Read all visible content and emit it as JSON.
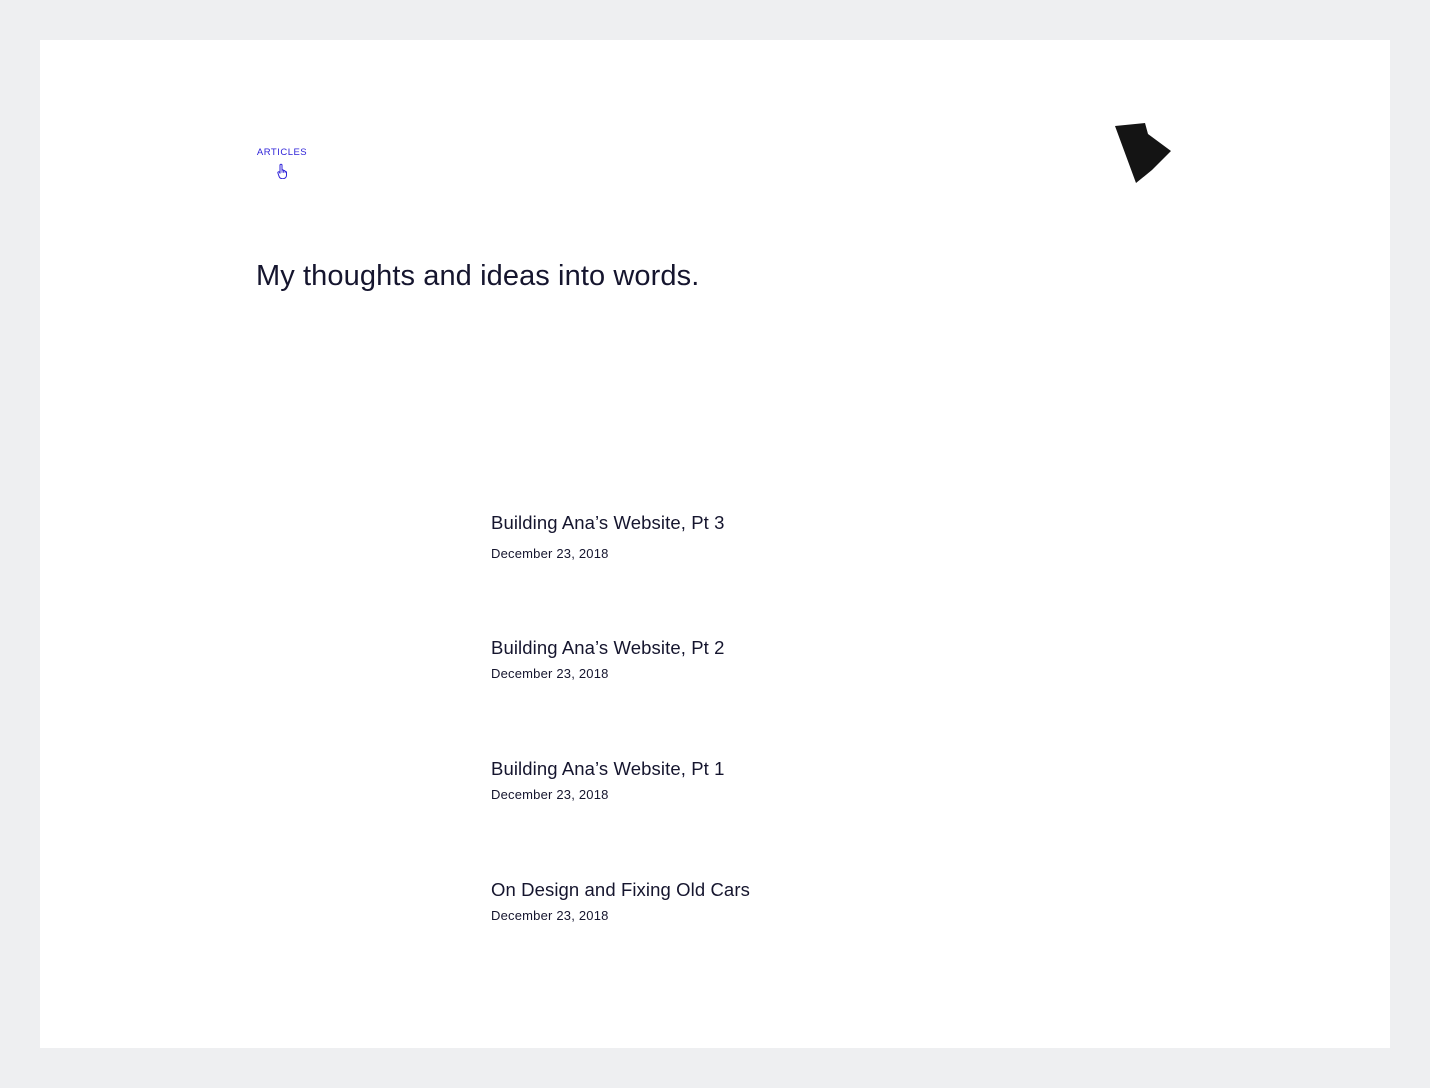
{
  "colors": {
    "background": "#eeeff1",
    "page": "#ffffff",
    "accent": "#2f23d8",
    "text": "#15152e",
    "logo": "#141414"
  },
  "nav": {
    "articles_label": "ARTICLES",
    "articles_icon": "pointing-hand-icon"
  },
  "logo": {
    "icon": "arrow-triangle-logo-icon"
  },
  "header": {
    "tagline": "My thoughts and ideas into words."
  },
  "articles": [
    {
      "title": "Building Ana’s Website, Pt 3",
      "date": "December 23, 2018"
    },
    {
      "title": "Building Ana’s Website, Pt 2",
      "date": "December 23, 2018"
    },
    {
      "title": "Building Ana’s Website, Pt 1",
      "date": "December 23, 2018"
    },
    {
      "title": "On Design and Fixing Old Cars",
      "date": "December 23, 2018"
    }
  ]
}
